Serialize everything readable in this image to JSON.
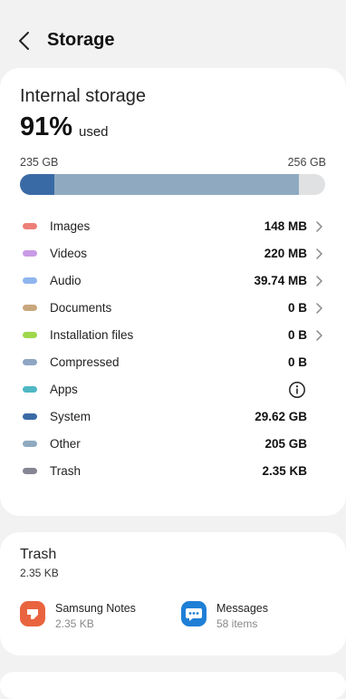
{
  "header": {
    "title": "Storage"
  },
  "storage": {
    "title": "Internal storage",
    "percent": "91%",
    "used_label": "used",
    "used_gb": "235 GB",
    "total_gb": "256 GB",
    "usage_fraction": 0.91,
    "bar_segments": [
      {
        "name": "System",
        "fraction": 0.113,
        "color": "#3a6aa5"
      },
      {
        "name": "Other",
        "fraction": 0.801,
        "color": "#8faac0"
      }
    ],
    "categories": [
      {
        "label": "Images",
        "size": "148 MB",
        "color": "#ec7f77",
        "action": "chevron"
      },
      {
        "label": "Videos",
        "size": "220 MB",
        "color": "#c89be6",
        "action": "chevron"
      },
      {
        "label": "Audio",
        "size": "39.74 MB",
        "color": "#8fb5ef",
        "action": "chevron"
      },
      {
        "label": "Documents",
        "size": "0 B",
        "color": "#c9a77d",
        "action": "chevron"
      },
      {
        "label": "Installation files",
        "size": "0 B",
        "color": "#9ed84a",
        "action": "chevron"
      },
      {
        "label": "Compressed",
        "size": "0 B",
        "color": "#8fa6c4",
        "action": "none"
      },
      {
        "label": "Apps",
        "size": "",
        "color": "#4fb7c4",
        "action": "info"
      },
      {
        "label": "System",
        "size": "29.62 GB",
        "color": "#3a6aa5",
        "action": "none"
      },
      {
        "label": "Other",
        "size": "205 GB",
        "color": "#8faac0",
        "action": "none"
      },
      {
        "label": "Trash",
        "size": "2.35 KB",
        "color": "#858594",
        "action": "none"
      }
    ]
  },
  "trash": {
    "title": "Trash",
    "size": "2.35 KB",
    "apps": [
      {
        "name": "Samsung Notes",
        "detail": "2.35 KB",
        "icon": "samsung-notes-icon",
        "color": "#e9643e"
      },
      {
        "name": "Messages",
        "detail": "58 items",
        "icon": "messages-icon",
        "color": "#1f7fd6"
      }
    ]
  }
}
